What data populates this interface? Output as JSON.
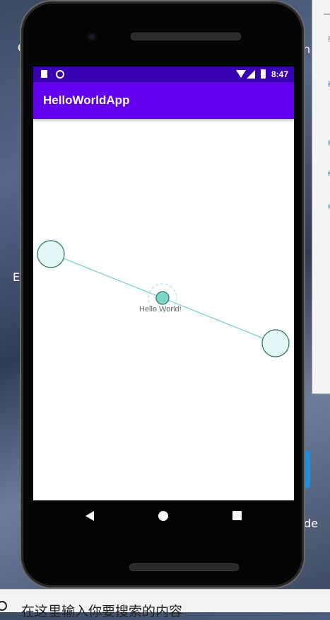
{
  "desktop": {
    "left_labels": [
      "C",
      "Ea"
    ],
    "right_labels": [
      "n",
      "de"
    ],
    "panel_glyphs": [
      "—",
      "©",
      "©",
      "©",
      "©",
      "©"
    ]
  },
  "statusbar": {
    "time": "8:47"
  },
  "app": {
    "title": "HelloWorldApp"
  },
  "canvas": {
    "center_label": "Hello World!"
  },
  "search": {
    "placeholder": "在这里输入你要搜索的内容"
  },
  "colors": {
    "status_bar": "#3700b3",
    "app_bar": "#6200ee",
    "node_fill": "#d9f5f0",
    "node_stroke": "#2c6e62",
    "center_node_fill": "#7ed8c9",
    "edge": "#58c9c0"
  }
}
